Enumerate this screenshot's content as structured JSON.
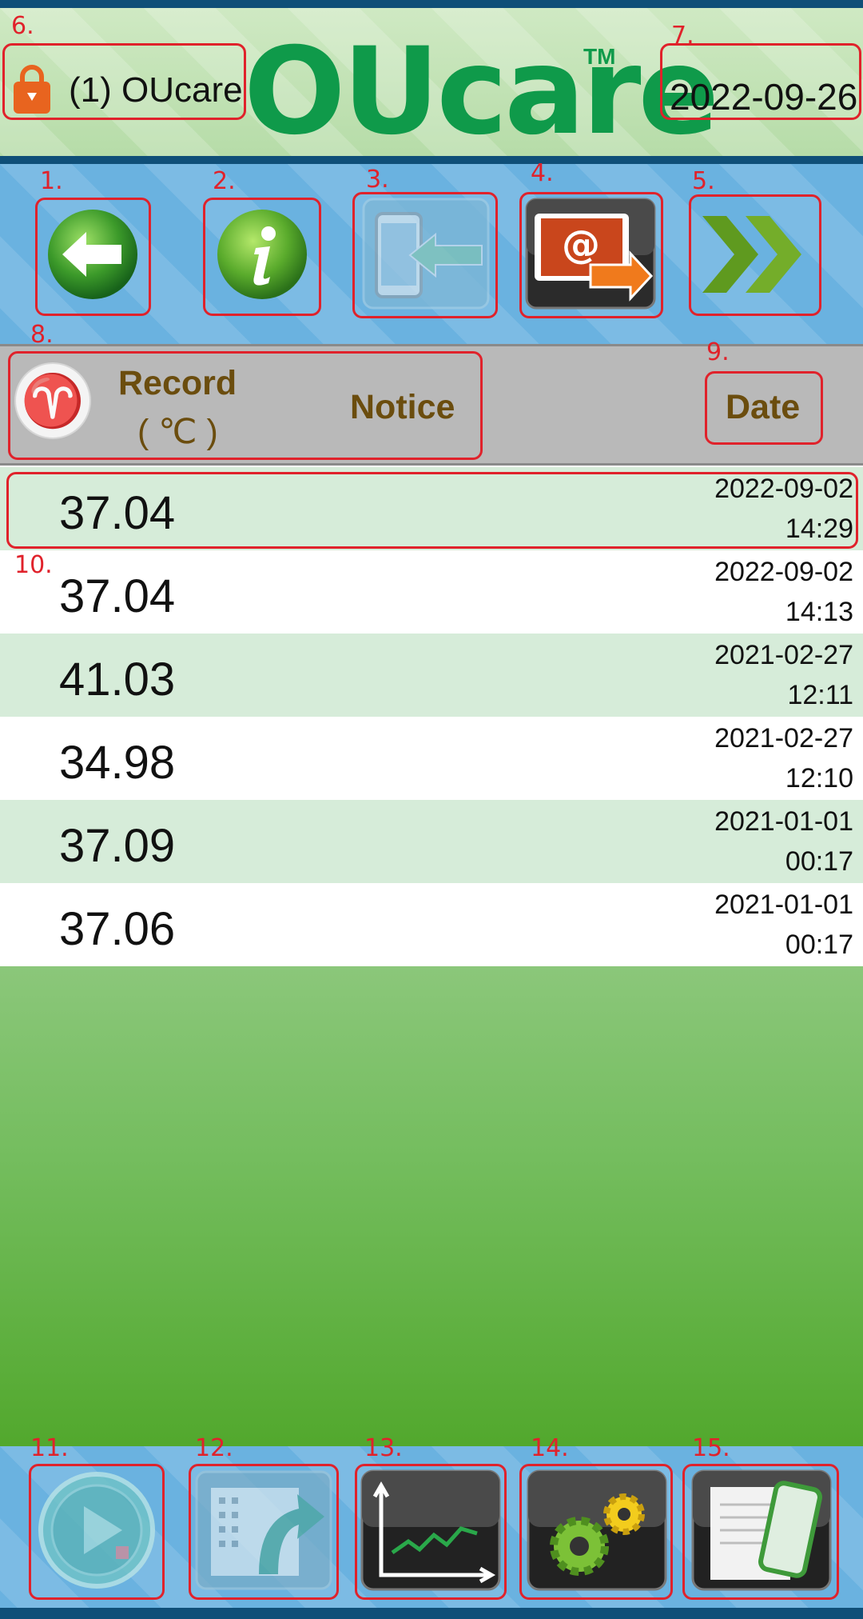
{
  "header": {
    "user_label": "(1) OUcare",
    "logo": "OUcare",
    "tm": "TM",
    "date": "2022-09-26"
  },
  "toolbar": {
    "buttons": [
      {
        "icon": "back-arrow-icon"
      },
      {
        "icon": "info-icon"
      },
      {
        "icon": "phone-import-icon"
      },
      {
        "icon": "email-export-icon"
      },
      {
        "icon": "next-double-arrow-icon"
      }
    ]
  },
  "table": {
    "record_label": "Record",
    "unit_label": "( ℃ )",
    "notice_label": "Notice",
    "date_label": "Date",
    "rows": [
      {
        "value": "37.04",
        "date": "2022-09-02",
        "time": "14:29"
      },
      {
        "value": "37.04",
        "date": "2022-09-02",
        "time": "14:13"
      },
      {
        "value": "41.03",
        "date": "2021-02-27",
        "time": "12:11"
      },
      {
        "value": "34.98",
        "date": "2021-02-27",
        "time": "12:10"
      },
      {
        "value": "37.09",
        "date": "2021-01-01",
        "time": "00:17"
      },
      {
        "value": "37.06",
        "date": "2021-01-01",
        "time": "00:17"
      }
    ]
  },
  "bottombar": {
    "buttons": [
      {
        "icon": "play-record-icon"
      },
      {
        "icon": "share-export-icon"
      },
      {
        "icon": "chart-icon"
      },
      {
        "icon": "settings-gears-icon"
      },
      {
        "icon": "phone-notes-icon"
      }
    ]
  },
  "annotations": [
    "1.",
    "2.",
    "3.",
    "4.",
    "5.",
    "6.",
    "7.",
    "8.",
    "9.",
    "10.",
    "11.",
    "12.",
    "13.",
    "14.",
    "15."
  ],
  "colors": {
    "brand_green": "#0f9a4a",
    "header_blue": "#0f4f78",
    "toolbar_blue": "#6ab2e0",
    "row_alt": "#d6ecd9",
    "header_text": "#6b4d0e",
    "annotation_red": "#e0222b"
  }
}
